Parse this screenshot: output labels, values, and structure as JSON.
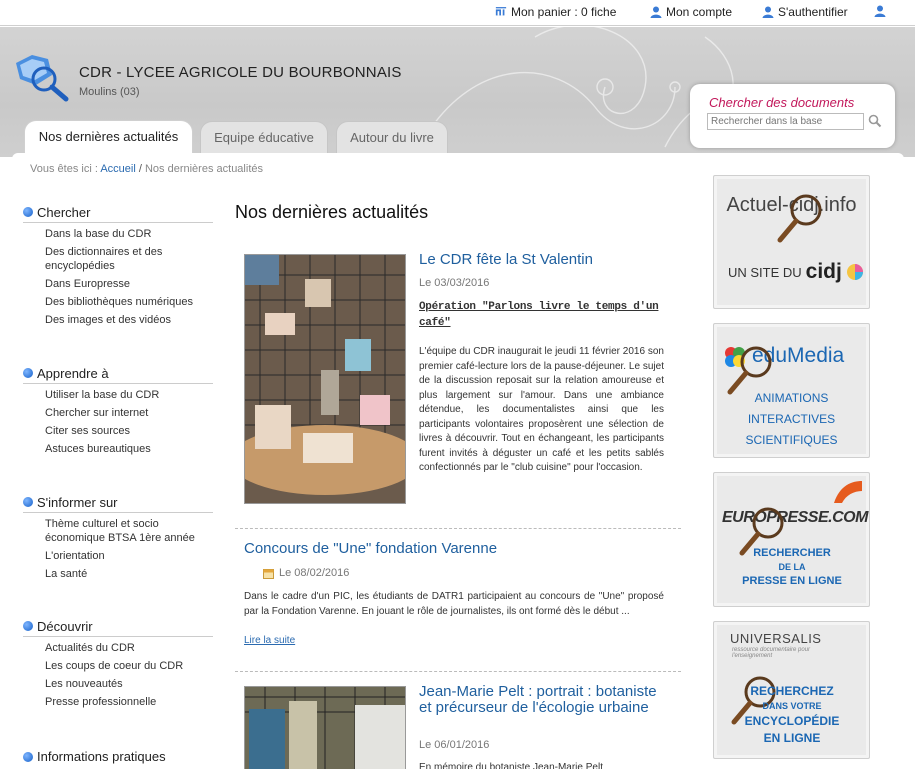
{
  "topbar": {
    "cart": "Mon panier : 0 fiche",
    "account": "Mon compte",
    "login": "S'authentifier"
  },
  "header": {
    "title": "CDR - LYCEE AGRICOLE DU BOURBONNAIS",
    "subtitle": "Moulins (03)"
  },
  "search": {
    "title": "Chercher des documents",
    "placeholder": "Rechercher dans la base"
  },
  "tabs": [
    {
      "label": "Nos dernières actualités"
    },
    {
      "label": "Equipe éducative"
    },
    {
      "label": "Autour du livre"
    }
  ],
  "breadcrumb": {
    "prefix": "Vous êtes ici :",
    "home": "Accueil",
    "separator": "/",
    "current": "Nos dernières actualités"
  },
  "sidebar": [
    {
      "title": "Chercher",
      "items": [
        "Dans la base du CDR",
        "Des dictionnaires et des encyclopédies",
        "Dans Europresse",
        "Des bibliothèques numériques",
        "Des images et des vidéos"
      ]
    },
    {
      "title": "Apprendre à",
      "items": [
        "Utiliser la base du CDR",
        "Chercher sur internet",
        "Citer ses sources",
        "Astuces bureautiques"
      ]
    },
    {
      "title": "S'informer sur",
      "items": [
        "Thème culturel et socio économique BTSA 1ère année",
        "L'orientation",
        "La santé"
      ]
    },
    {
      "title": "Découvrir",
      "items": [
        "Actualités du CDR",
        "Les coups de coeur du CDR",
        "Les nouveautés",
        "Presse professionnelle"
      ]
    },
    {
      "title": "Informations pratiques",
      "items": []
    }
  ],
  "main": {
    "title": "Nos dernières actualités",
    "articles": [
      {
        "title": "Le CDR fête la St Valentin",
        "date": "Le 03/03/2016",
        "subtitle": "Opération \"Parlons livre le temps d'un café\"",
        "text": "L'équipe du CDR inaugurait le jeudi 11 février 2016 son premier café-lecture lors de la pause-déjeuner. Le sujet de la discussion reposait sur la relation amoureuse et plus largement sur l'amour. Dans une ambiance détendue, les documentalistes ainsi que les participants volontaires proposèrent une sélection de livres à découvrir. Tout en échangeant, les participants furent invités à déguster un café et les petits sablés confectionnés par le \"club cuisine\" pour l'occasion."
      },
      {
        "title": "Concours de \"Une\" fondation Varenne",
        "date": "Le 08/02/2016",
        "text": "Dans le cadre d'un PIC, les étudiants de DATR1 participaient au concours de \"Une\" proposé par la Fondation Varenne. En jouant le rôle de journalistes, ils ont formé dès le début ...",
        "more": "Lire la suite"
      },
      {
        "title": "Jean-Marie Pelt : portrait : botaniste et précurseur de l'écologie urbaine",
        "date": "Le 06/01/2016",
        "text": "En mémoire du botaniste Jean-Marie Pelt"
      }
    ]
  },
  "banners": {
    "cidj": {
      "line1": "Actuel-cidj.info",
      "line2": "UN SITE DU",
      "brand": "cidj"
    },
    "edumedia": {
      "brand": "eduMedia",
      "lines": [
        "ANIMATIONS",
        "INTERACTIVES",
        "SCIENTIFIQUES"
      ]
    },
    "europresse": {
      "brand": "EUROPRESSE.COM",
      "lines": [
        "RECHERCHER",
        "DE LA",
        "PRESSE EN LIGNE"
      ]
    },
    "universalis": {
      "brand": "UNIVERSALIS",
      "tagline": "ressource documentaire pour l'enseignement",
      "lines": [
        "RECHERCHEZ",
        "DANS VOTRE",
        "ENCYCLOPÉDIE",
        "EN LIGNE"
      ]
    }
  },
  "colors": {
    "link": "#1f5f9e",
    "accent_pink": "#c2185b",
    "blue": "#1b67b3"
  }
}
